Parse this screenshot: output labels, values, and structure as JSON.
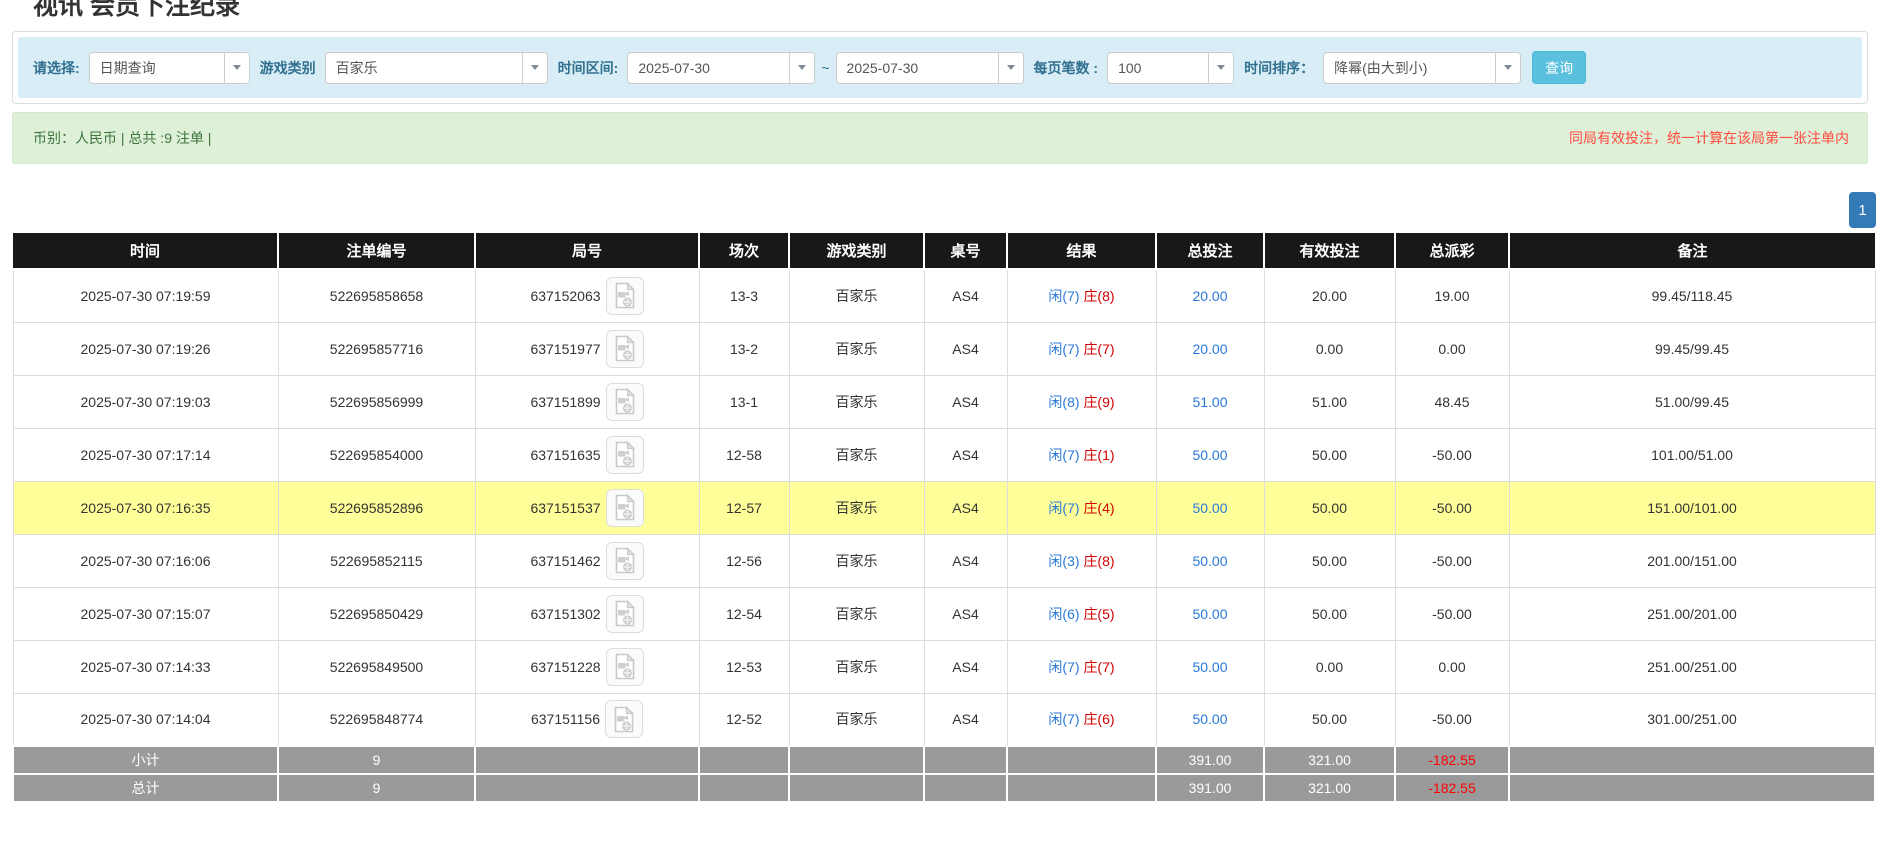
{
  "page": {
    "title": "视讯 会员下注纪录"
  },
  "filters": {
    "select_label": "请选择:",
    "select_value": "日期查询",
    "game_type_label": "游戏类别",
    "game_type_value": "百家乐",
    "time_range_label": "时间区间:",
    "date_from": "2025-07-30",
    "date_separator": "~",
    "date_to": "2025-07-30",
    "page_size_label": "每页笔数 :",
    "page_size_value": "100",
    "sort_label": "时间排序：",
    "sort_value": "降幂(由大到小)",
    "search_button": "查询"
  },
  "summary": {
    "left_text": "币别：人民币 | 总共 :9 注单 |",
    "right_notice": "同局有效投注，统一计算在该局第一张注单内"
  },
  "pagination": {
    "current_page": "1"
  },
  "table": {
    "headers": [
      "时间",
      "注单编号",
      "局号",
      "场次",
      "游戏类别",
      "桌号",
      "结果",
      "总投注",
      "有效投注",
      "总派彩",
      "备注"
    ],
    "rows": [
      {
        "time": "2025-07-30 07:19:59",
        "bet_id": "522695858658",
        "round_id": "637152063",
        "session": "13-3",
        "game": "百家乐",
        "table_no": "AS4",
        "result_player": "闲(7)",
        "result_banker": "庄(8)",
        "total_bet": "20.00",
        "valid_bet": "20.00",
        "payout": "19.00",
        "remark": "99.45/118.45",
        "highlight": false
      },
      {
        "time": "2025-07-30 07:19:26",
        "bet_id": "522695857716",
        "round_id": "637151977",
        "session": "13-2",
        "game": "百家乐",
        "table_no": "AS4",
        "result_player": "闲(7)",
        "result_banker": "庄(7)",
        "total_bet": "20.00",
        "valid_bet": "0.00",
        "payout": "0.00",
        "remark": "99.45/99.45",
        "highlight": false
      },
      {
        "time": "2025-07-30 07:19:03",
        "bet_id": "522695856999",
        "round_id": "637151899",
        "session": "13-1",
        "game": "百家乐",
        "table_no": "AS4",
        "result_player": "闲(8)",
        "result_banker": "庄(9)",
        "total_bet": "51.00",
        "valid_bet": "51.00",
        "payout": "48.45",
        "remark": "51.00/99.45",
        "highlight": false
      },
      {
        "time": "2025-07-30 07:17:14",
        "bet_id": "522695854000",
        "round_id": "637151635",
        "session": "12-58",
        "game": "百家乐",
        "table_no": "AS4",
        "result_player": "闲(7)",
        "result_banker": "庄(1)",
        "total_bet": "50.00",
        "valid_bet": "50.00",
        "payout": "-50.00",
        "remark": "101.00/51.00",
        "highlight": false
      },
      {
        "time": "2025-07-30 07:16:35",
        "bet_id": "522695852896",
        "round_id": "637151537",
        "session": "12-57",
        "game": "百家乐",
        "table_no": "AS4",
        "result_player": "闲(7)",
        "result_banker": "庄(4)",
        "total_bet": "50.00",
        "valid_bet": "50.00",
        "payout": "-50.00",
        "remark": "151.00/101.00",
        "highlight": true
      },
      {
        "time": "2025-07-30 07:16:06",
        "bet_id": "522695852115",
        "round_id": "637151462",
        "session": "12-56",
        "game": "百家乐",
        "table_no": "AS4",
        "result_player": "闲(3)",
        "result_banker": "庄(8)",
        "total_bet": "50.00",
        "valid_bet": "50.00",
        "payout": "-50.00",
        "remark": "201.00/151.00",
        "highlight": false
      },
      {
        "time": "2025-07-30 07:15:07",
        "bet_id": "522695850429",
        "round_id": "637151302",
        "session": "12-54",
        "game": "百家乐",
        "table_no": "AS4",
        "result_player": "闲(6)",
        "result_banker": "庄(5)",
        "total_bet": "50.00",
        "valid_bet": "50.00",
        "payout": "-50.00",
        "remark": "251.00/201.00",
        "highlight": false
      },
      {
        "time": "2025-07-30 07:14:33",
        "bet_id": "522695849500",
        "round_id": "637151228",
        "session": "12-53",
        "game": "百家乐",
        "table_no": "AS4",
        "result_player": "闲(7)",
        "result_banker": "庄(7)",
        "total_bet": "50.00",
        "valid_bet": "0.00",
        "payout": "0.00",
        "remark": "251.00/251.00",
        "highlight": false
      },
      {
        "time": "2025-07-30 07:14:04",
        "bet_id": "522695848774",
        "round_id": "637151156",
        "session": "12-52",
        "game": "百家乐",
        "table_no": "AS4",
        "result_player": "闲(7)",
        "result_banker": "庄(6)",
        "total_bet": "50.00",
        "valid_bet": "50.00",
        "payout": "-50.00",
        "remark": "301.00/251.00",
        "highlight": false
      }
    ],
    "footer_rows": [
      {
        "label": "小计",
        "count": "9",
        "total_bet": "391.00",
        "valid_bet": "321.00",
        "payout": "-182.55"
      },
      {
        "label": "总计",
        "count": "9",
        "total_bet": "391.00",
        "valid_bet": "321.00",
        "payout": "-182.55"
      }
    ]
  },
  "colors": {
    "header_bg": "#181818",
    "footer_bg": "#9a9a9a",
    "highlight_row": "#ffff99",
    "link_blue": "#2979d9",
    "banker_red": "#d40000",
    "negative_red": "#ff0000",
    "notice_red": "#ff4a3f",
    "summary_bg": "#dff0d8",
    "filter_bg": "#d9edf7",
    "search_button_bg": "#5bc0de",
    "pagination_bg": "#337ab7"
  }
}
